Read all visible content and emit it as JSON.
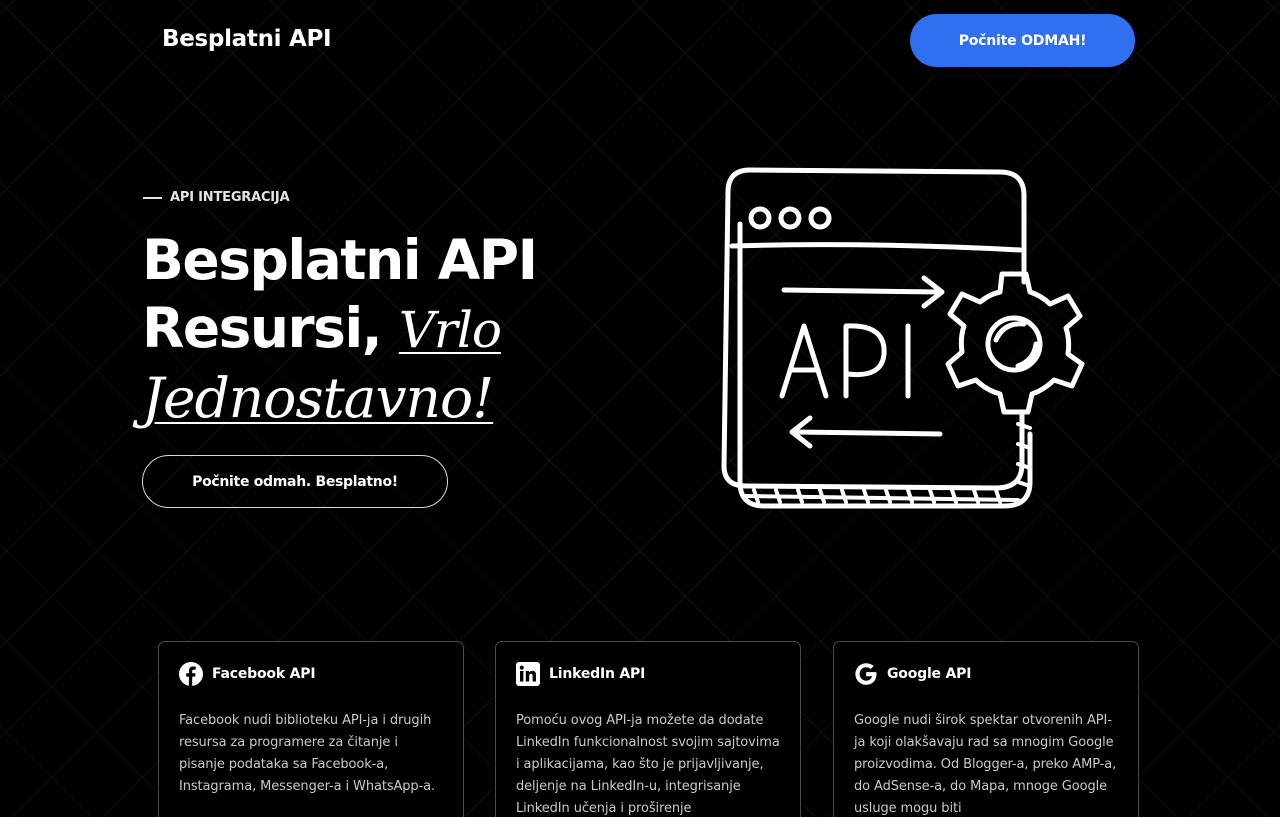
{
  "header": {
    "brand": "Besplatni API",
    "cta_label": "Počnite ODMAH!"
  },
  "hero": {
    "eyebrow": "API INTEGRACIJA",
    "title_line1": "Besplatni API",
    "title_line2_bold": "Resursi,",
    "title_line2_italic": "Vrlo",
    "title_line3_italic": "Jednostavno!",
    "cta_label": "Počnite odmah. Besplatno!",
    "illustration_text": "API"
  },
  "cards": [
    {
      "icon": "facebook-icon",
      "title": "Facebook API",
      "description": "Facebook nudi biblioteku API-ja i drugih resursa za programere za čitanje i pisanje podataka sa Facebook-a, Instagrama, Messenger-a i WhatsApp-a."
    },
    {
      "icon": "linkedin-icon",
      "title": "LinkedIn API",
      "description": "Pomoću ovog API-ja možete da dodate LinkedIn funkcionalnost svojim sajtovima i aplikacijama, kao što je prijavljivanje, deljenje na LinkedIn-u, integrisanje LinkedIn učenja i proširenje"
    },
    {
      "icon": "google-icon",
      "title": "Google API",
      "description": "Google nudi širok spektar otvorenih API-ja koji olakšavaju rad sa mnogim Google proizvodima. Od Blogger-a, preko AMP-a, do AdSense-a, do Mapa, mnoge Google usluge mogu biti"
    }
  ],
  "colors": {
    "background": "#000000",
    "accent_blue": "#2f6ff0",
    "text": "#ffffff",
    "card_border": "#4a4a4a"
  }
}
